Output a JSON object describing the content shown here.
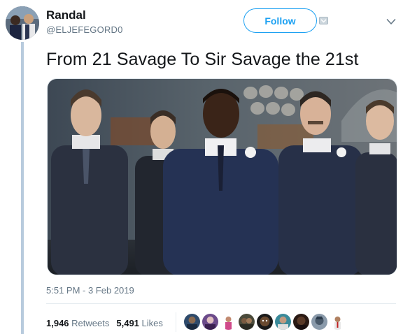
{
  "user": {
    "name": "Randal",
    "handle": "@ELJEFEGORD0"
  },
  "header": {
    "follow_label": "Follow"
  },
  "tweet": {
    "text": "From 21 Savage To Sir Savage the 21st",
    "timestamp": "5:51 PM - 3 Feb 2019"
  },
  "stats": {
    "retweets_count": "1,946",
    "retweets_label": "Retweets",
    "likes_count": "5,491",
    "likes_label": "Likes"
  },
  "colors": {
    "accent": "#1da1f2",
    "secondary_text": "#657786",
    "thread_line": "#b8cbdd"
  },
  "icons": {
    "follow_extra": "caret-icon",
    "menu": "chevron-down-icon"
  }
}
